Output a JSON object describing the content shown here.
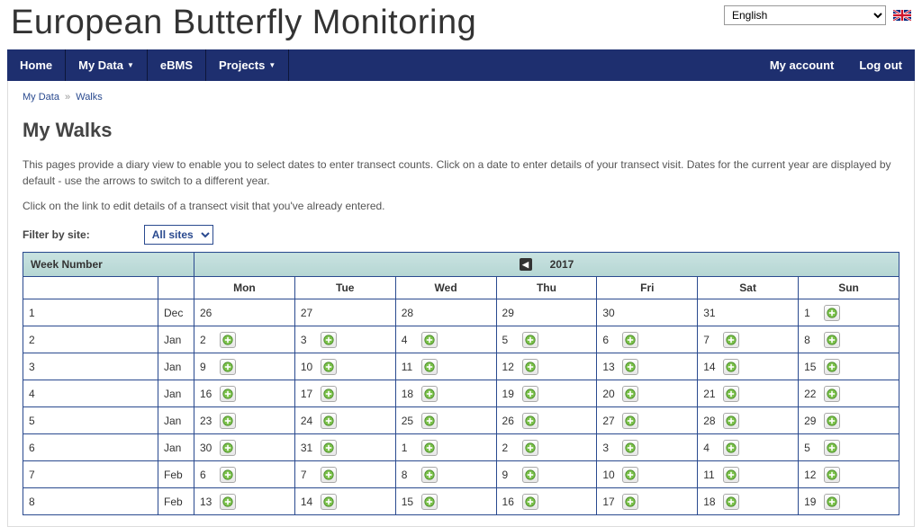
{
  "header": {
    "site_title": "European Butterfly Monitoring",
    "language_selected": "English"
  },
  "nav": {
    "left": [
      {
        "label": "Home",
        "dropdown": false
      },
      {
        "label": "My Data",
        "dropdown": true
      },
      {
        "label": "eBMS",
        "dropdown": false
      },
      {
        "label": "Projects",
        "dropdown": true
      }
    ],
    "right": [
      {
        "label": "My account"
      },
      {
        "label": "Log out"
      }
    ]
  },
  "breadcrumb": {
    "parent": "My Data",
    "sep": "»",
    "current": "Walks"
  },
  "page": {
    "title": "My Walks",
    "intro1": "This pages provide a diary view to enable you to select dates to enter transect counts.  Click on a date to enter details of your transect visit.  Dates for the current year are displayed by default - use the arrows to switch to a different year.",
    "intro2": "Click on the link to edit details of a transect visit that you've already entered.",
    "filter_label": "Filter by site:",
    "filter_selected": "All sites"
  },
  "calendar": {
    "week_header": "Week Number",
    "year": "2017",
    "dow": [
      "Mon",
      "Tue",
      "Wed",
      "Thu",
      "Fri",
      "Sat",
      "Sun"
    ],
    "rows": [
      {
        "week": "1",
        "month": "Dec",
        "days": [
          {
            "n": "26",
            "add": false
          },
          {
            "n": "27",
            "add": false
          },
          {
            "n": "28",
            "add": false
          },
          {
            "n": "29",
            "add": false
          },
          {
            "n": "30",
            "add": false
          },
          {
            "n": "31",
            "add": false
          },
          {
            "n": "1",
            "add": true
          }
        ]
      },
      {
        "week": "2",
        "month": "Jan",
        "days": [
          {
            "n": "2",
            "add": true
          },
          {
            "n": "3",
            "add": true
          },
          {
            "n": "4",
            "add": true
          },
          {
            "n": "5",
            "add": true
          },
          {
            "n": "6",
            "add": true
          },
          {
            "n": "7",
            "add": true
          },
          {
            "n": "8",
            "add": true
          }
        ]
      },
      {
        "week": "3",
        "month": "Jan",
        "days": [
          {
            "n": "9",
            "add": true
          },
          {
            "n": "10",
            "add": true
          },
          {
            "n": "11",
            "add": true
          },
          {
            "n": "12",
            "add": true
          },
          {
            "n": "13",
            "add": true
          },
          {
            "n": "14",
            "add": true
          },
          {
            "n": "15",
            "add": true
          }
        ]
      },
      {
        "week": "4",
        "month": "Jan",
        "days": [
          {
            "n": "16",
            "add": true
          },
          {
            "n": "17",
            "add": true
          },
          {
            "n": "18",
            "add": true
          },
          {
            "n": "19",
            "add": true
          },
          {
            "n": "20",
            "add": true
          },
          {
            "n": "21",
            "add": true
          },
          {
            "n": "22",
            "add": true
          }
        ]
      },
      {
        "week": "5",
        "month": "Jan",
        "days": [
          {
            "n": "23",
            "add": true
          },
          {
            "n": "24",
            "add": true
          },
          {
            "n": "25",
            "add": true
          },
          {
            "n": "26",
            "add": true
          },
          {
            "n": "27",
            "add": true
          },
          {
            "n": "28",
            "add": true
          },
          {
            "n": "29",
            "add": true
          }
        ]
      },
      {
        "week": "6",
        "month": "Jan",
        "days": [
          {
            "n": "30",
            "add": true
          },
          {
            "n": "31",
            "add": true
          },
          {
            "n": "1",
            "add": true
          },
          {
            "n": "2",
            "add": true
          },
          {
            "n": "3",
            "add": true
          },
          {
            "n": "4",
            "add": true
          },
          {
            "n": "5",
            "add": true
          }
        ]
      },
      {
        "week": "7",
        "month": "Feb",
        "days": [
          {
            "n": "6",
            "add": true
          },
          {
            "n": "7",
            "add": true
          },
          {
            "n": "8",
            "add": true
          },
          {
            "n": "9",
            "add": true
          },
          {
            "n": "10",
            "add": true
          },
          {
            "n": "11",
            "add": true
          },
          {
            "n": "12",
            "add": true
          }
        ]
      },
      {
        "week": "8",
        "month": "Feb",
        "days": [
          {
            "n": "13",
            "add": true
          },
          {
            "n": "14",
            "add": true
          },
          {
            "n": "15",
            "add": true
          },
          {
            "n": "16",
            "add": true
          },
          {
            "n": "17",
            "add": true
          },
          {
            "n": "18",
            "add": true
          },
          {
            "n": "19",
            "add": true
          }
        ]
      }
    ]
  }
}
